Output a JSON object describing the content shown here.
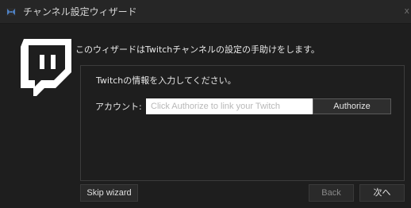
{
  "window": {
    "title": "チャンネル設定ウィザード",
    "close_glyph": "x",
    "app_icon": "twitch-app-icon"
  },
  "intro": {
    "text": "このウィザードはTwitchチャンネルの設定の手助けをします。"
  },
  "logo": {
    "icon": "twitch-logo-icon",
    "accent_color": "#ffffff"
  },
  "group": {
    "prompt": "Twitchの情報を入力してください。",
    "account_label": "アカウント:",
    "account_value": "",
    "account_placeholder": "Click Authorize to link your Twitch",
    "authorize_label": "Authorize"
  },
  "footer": {
    "skip_label": "Skip wizard",
    "back_label": "Back",
    "next_label": "次へ"
  },
  "colors": {
    "background": "#1e1e1e",
    "titlebar": "#262626",
    "app_icon_accent": "#4d7fbf"
  }
}
